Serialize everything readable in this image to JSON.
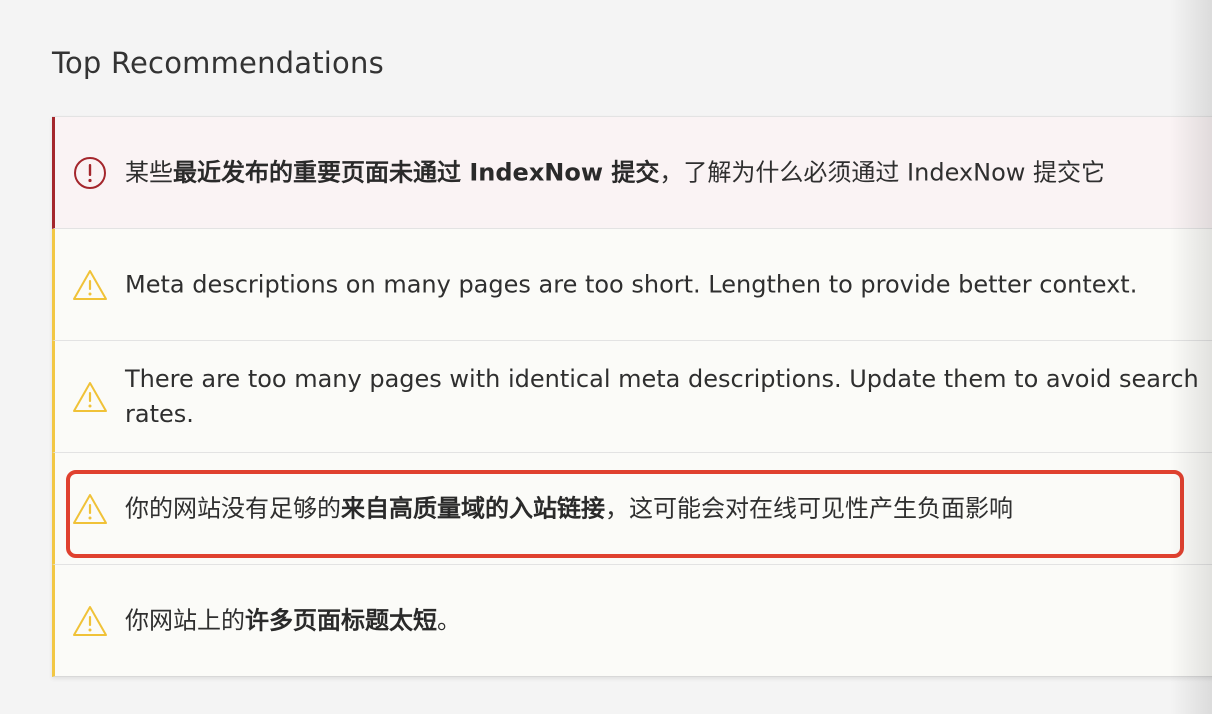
{
  "section": {
    "title": "Top Recommendations"
  },
  "recommendations": [
    {
      "severity": "error",
      "icon": "error-circle-icon",
      "text_before": "某些",
      "text_bold": "最近发布的重要页面未通过 IndexNow 提交",
      "text_after": "，了解为什么必须通过 IndexNow 提交它"
    },
    {
      "severity": "warning",
      "icon": "warning-triangle-icon",
      "text_before": "Meta descriptions on many pages are too short. Lengthen to provide better context.",
      "text_bold": "",
      "text_after": ""
    },
    {
      "severity": "warning",
      "icon": "warning-triangle-icon",
      "text_before": "There are too many pages with identical meta descriptions. Update them to avoid search rates.",
      "text_bold": "",
      "text_after": ""
    },
    {
      "severity": "warning",
      "icon": "warning-triangle-icon",
      "text_before": "你的网站没有足够的",
      "text_bold": "来自高质量域的入站链接",
      "text_after": "，这可能会对在线可见性产生负面影响"
    },
    {
      "severity": "warning",
      "icon": "warning-triangle-icon",
      "text_before": "你网站上的",
      "text_bold": "许多页面标题太短",
      "text_after": "。"
    }
  ],
  "colors": {
    "error_accent": "#a4262c",
    "warning_accent": "#f2c744",
    "highlight_outline": "#e0412f"
  }
}
